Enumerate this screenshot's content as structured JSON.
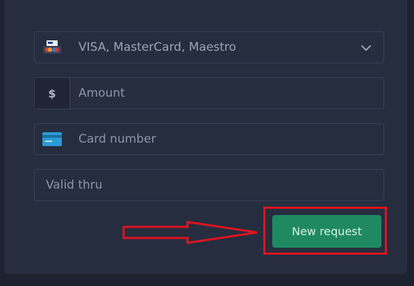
{
  "form": {
    "payment_method": {
      "value": "VISA, MasterCard, Maestro",
      "icon": "card-brands-icon"
    },
    "amount": {
      "prefix": "$",
      "placeholder": "Amount"
    },
    "card_number": {
      "placeholder": "Card number",
      "icon": "credit-card-icon"
    },
    "valid_thru": {
      "placeholder": "Valid thru"
    },
    "submit_label": "New request"
  },
  "colors": {
    "background": "#1d2230",
    "panel": "#262d3f",
    "field_border": "#394257",
    "button": "#1f8a62",
    "annotation_red": "#e0141f"
  }
}
